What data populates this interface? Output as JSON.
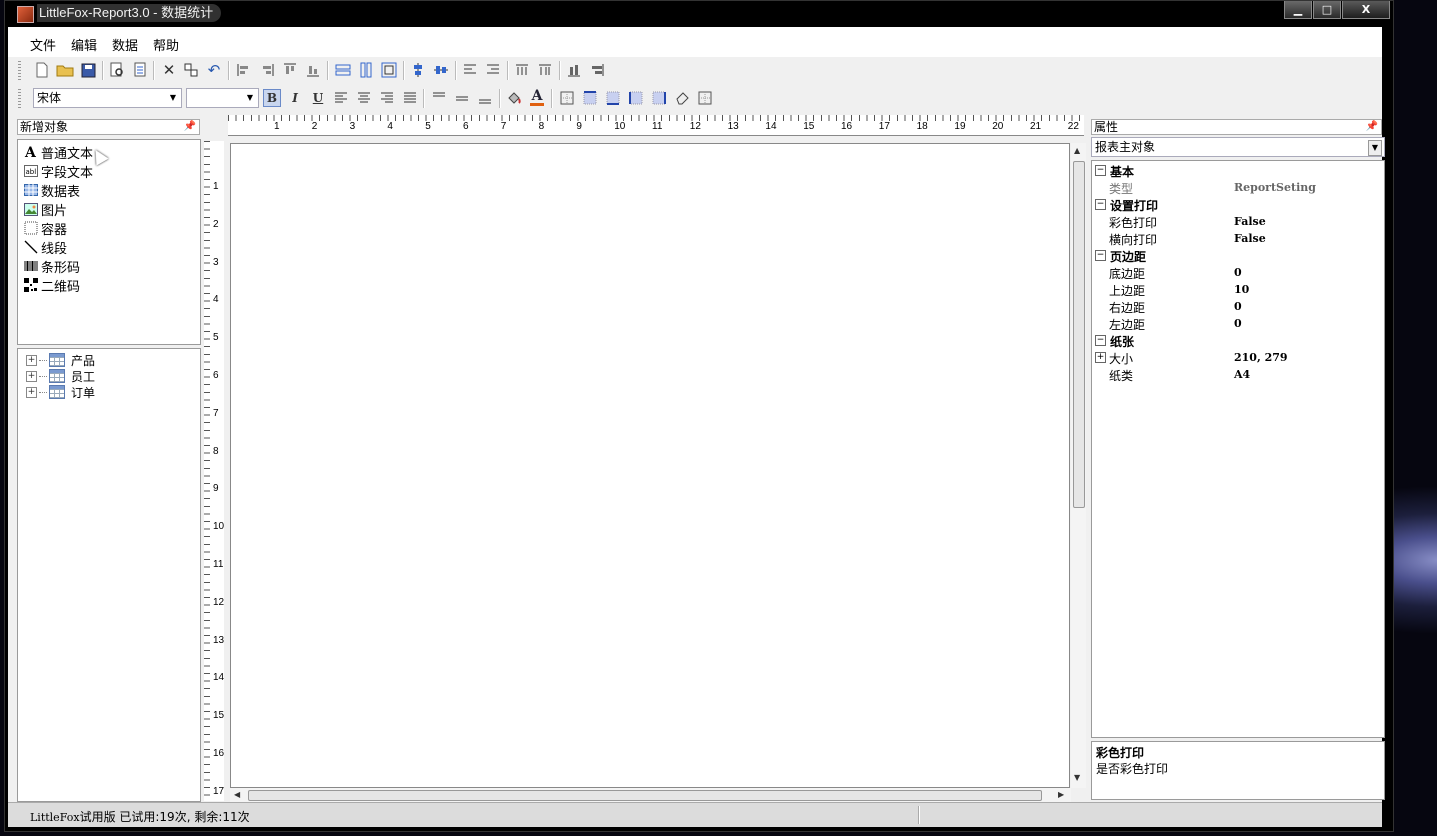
{
  "window": {
    "title": "LittleFox-Report3.0 - 数据统计",
    "controls": {
      "minimize": "▁",
      "maximize": "□",
      "close": "X"
    }
  },
  "menu": [
    "文件",
    "编辑",
    "数据",
    "帮助"
  ],
  "toolbar2": {
    "font_name": "宋体",
    "font_size": "",
    "bold": "B",
    "italic": "I",
    "underline": "U",
    "font_color_glyph": "A"
  },
  "objects_panel": {
    "title": "新增对象",
    "items": [
      {
        "label": "普通文本",
        "icon": "text-a-icon"
      },
      {
        "label": "字段文本",
        "icon": "field-text-icon"
      },
      {
        "label": "数据表",
        "icon": "grid-table-icon"
      },
      {
        "label": "图片",
        "icon": "image-icon"
      },
      {
        "label": "容器",
        "icon": "container-icon"
      },
      {
        "label": "线段",
        "icon": "line-icon"
      },
      {
        "label": "条形码",
        "icon": "barcode-icon"
      },
      {
        "label": "二维码",
        "icon": "qrcode-icon"
      }
    ]
  },
  "data_tree": {
    "items": [
      "产品",
      "员工",
      "订单"
    ]
  },
  "ruler": {
    "h_labels": [
      "1",
      "2",
      "3",
      "4",
      "5",
      "6",
      "7",
      "8",
      "9",
      "10",
      "11",
      "12",
      "13",
      "14",
      "15",
      "16",
      "17",
      "18",
      "19",
      "20",
      "21",
      "22"
    ],
    "v_labels": [
      "1",
      "2",
      "3",
      "4",
      "5",
      "6",
      "7",
      "8",
      "9",
      "10",
      "11",
      "12",
      "13",
      "14",
      "15",
      "16",
      "17"
    ]
  },
  "properties": {
    "title": "属性",
    "selected_object": "报表主对象",
    "rows": [
      {
        "kind": "cat",
        "name": "基本",
        "exp": "⊟"
      },
      {
        "kind": "prop",
        "name": "类型",
        "value": "ReportSeting",
        "gray": true
      },
      {
        "kind": "cat",
        "name": "设置打印",
        "exp": "⊟"
      },
      {
        "kind": "prop",
        "name": "彩色打印",
        "value": "False"
      },
      {
        "kind": "prop",
        "name": "横向打印",
        "value": "False"
      },
      {
        "kind": "cat",
        "name": "页边距",
        "exp": "⊟"
      },
      {
        "kind": "prop",
        "name": "底边距",
        "value": "0"
      },
      {
        "kind": "prop",
        "name": "上边距",
        "value": "10"
      },
      {
        "kind": "prop",
        "name": "右边距",
        "value": "0"
      },
      {
        "kind": "prop",
        "name": "左边距",
        "value": "0"
      },
      {
        "kind": "cat",
        "name": "纸张",
        "exp": "⊟"
      },
      {
        "kind": "prop",
        "name": "大小",
        "value": "210, 279",
        "expandable": true
      },
      {
        "kind": "prop",
        "name": "纸类",
        "value": "A4"
      }
    ],
    "description": {
      "title": "彩色打印",
      "text": "是否彩色打印"
    }
  },
  "status": {
    "product": "LittleFox",
    "text": "试用版 已试用:19次, 剩余:11次"
  }
}
